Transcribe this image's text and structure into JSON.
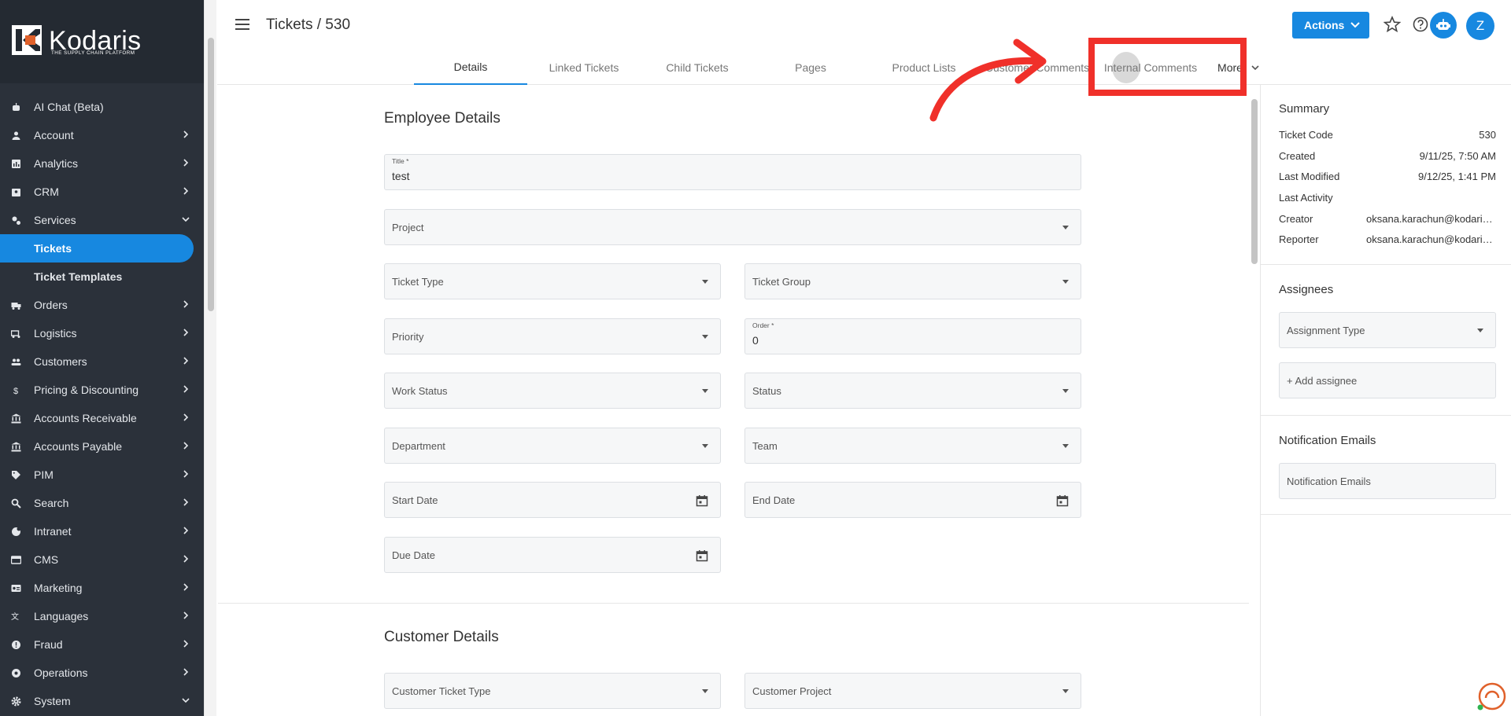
{
  "app": {
    "logo_text": "Kodaris",
    "logo_tagline": "THE SUPPLY CHAIN PLATFORM"
  },
  "sidebar": {
    "items": [
      {
        "label": "AI Chat (Beta)",
        "icon": "robot-icon",
        "chevron": "none"
      },
      {
        "label": "Account",
        "icon": "person-icon",
        "chevron": "right"
      },
      {
        "label": "Analytics",
        "icon": "analytics-icon",
        "chevron": "right"
      },
      {
        "label": "CRM",
        "icon": "crm-icon",
        "chevron": "right"
      },
      {
        "label": "Services",
        "icon": "services-icon",
        "chevron": "down"
      },
      {
        "label": "Tickets",
        "icon": "",
        "chevron": "none",
        "active": true,
        "sub": true
      },
      {
        "label": "Ticket Templates",
        "icon": "",
        "chevron": "none",
        "sub": true
      },
      {
        "label": "Orders",
        "icon": "truck-icon",
        "chevron": "right"
      },
      {
        "label": "Logistics",
        "icon": "logistics-icon",
        "chevron": "right"
      },
      {
        "label": "Customers",
        "icon": "people-icon",
        "chevron": "right"
      },
      {
        "label": "Pricing & Discounting",
        "icon": "dollar-icon",
        "chevron": "right"
      },
      {
        "label": "Accounts Receivable",
        "icon": "bank-icon",
        "chevron": "right"
      },
      {
        "label": "Accounts Payable",
        "icon": "bank-icon",
        "chevron": "right"
      },
      {
        "label": "PIM",
        "icon": "tag-icon",
        "chevron": "right"
      },
      {
        "label": "Search",
        "icon": "search-icon",
        "chevron": "right"
      },
      {
        "label": "Intranet",
        "icon": "globe-icon",
        "chevron": "right"
      },
      {
        "label": "CMS",
        "icon": "cms-icon",
        "chevron": "right"
      },
      {
        "label": "Marketing",
        "icon": "marketing-icon",
        "chevron": "right"
      },
      {
        "label": "Languages",
        "icon": "translate-icon",
        "chevron": "right"
      },
      {
        "label": "Fraud",
        "icon": "alert-icon",
        "chevron": "right"
      },
      {
        "label": "Operations",
        "icon": "operations-icon",
        "chevron": "right"
      },
      {
        "label": "System",
        "icon": "gear-icon",
        "chevron": "down"
      }
    ]
  },
  "header": {
    "breadcrumb": "Tickets / 530",
    "actions_label": "Actions",
    "avatar_initial": "Z"
  },
  "tabs": [
    {
      "label": "Details",
      "active": true
    },
    {
      "label": "Linked Tickets"
    },
    {
      "label": "Child Tickets"
    },
    {
      "label": "Pages"
    },
    {
      "label": "Product Lists"
    },
    {
      "label": "Customer Comments"
    },
    {
      "label": "Internal Comments"
    },
    {
      "label": "More"
    }
  ],
  "employee_details": {
    "title": "Employee Details",
    "title_field": {
      "label": "Title *",
      "value": "test"
    },
    "project": "Project",
    "ticket_type": "Ticket Type",
    "ticket_group": "Ticket Group",
    "priority": "Priority",
    "order_field": {
      "label": "Order *",
      "value": "0"
    },
    "work_status": "Work Status",
    "status": "Status",
    "department": "Department",
    "team": "Team",
    "start_date": "Start Date",
    "end_date": "End Date",
    "due_date": "Due Date"
  },
  "customer_details": {
    "title": "Customer Details",
    "customer_ticket_type": "Customer Ticket Type",
    "customer_project": "Customer Project"
  },
  "summary": {
    "title": "Summary",
    "rows": [
      {
        "label": "Ticket Code",
        "value": "530"
      },
      {
        "label": "Created",
        "value": "9/11/25, 7:50 AM"
      },
      {
        "label": "Last Modified",
        "value": "9/12/25, 1:41 PM"
      },
      {
        "label": "Last Activity",
        "value": ""
      },
      {
        "label": "Creator",
        "value": "oksana.karachun@kodaris.com"
      },
      {
        "label": "Reporter",
        "value": "oksana.karachun@kodaris.com"
      }
    ]
  },
  "assignees": {
    "title": "Assignees",
    "assignment_type": "Assignment Type",
    "add_assignee": "+ Add assignee"
  },
  "notification_emails": {
    "title": "Notification Emails",
    "placeholder": "Notification Emails"
  },
  "colors": {
    "accent": "#1788e0",
    "sidebar_bg": "#2b313a",
    "highlight": "#f0302a"
  }
}
